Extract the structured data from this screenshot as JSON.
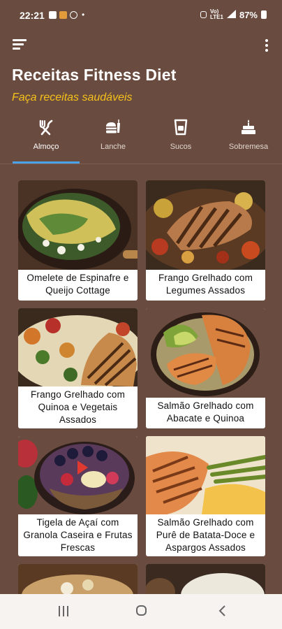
{
  "status": {
    "time": "22:21",
    "battery": "87%"
  },
  "header": {
    "title": "Receitas Fitness Diet",
    "subtitle": "Faça receitas saudáveis"
  },
  "tabs": [
    {
      "label": "Almoço",
      "icon": "cutlery-icon",
      "active": true
    },
    {
      "label": "Lanche",
      "icon": "burger-icon",
      "active": false
    },
    {
      "label": "Sucos",
      "icon": "cup-icon",
      "active": false
    },
    {
      "label": "Sobremesa",
      "icon": "cake-icon",
      "active": false
    }
  ],
  "recipes": [
    {
      "name_l1": "Omelete de Espinafre e",
      "name_l2": "Queijo Cottage",
      "name_l3": ""
    },
    {
      "name_l1": "Frango Grelhado com",
      "name_l2": "Legumes Assados",
      "name_l3": ""
    },
    {
      "name_l1": "Frango Grelhado com",
      "name_l2": "Quinoa e Vegetais",
      "name_l3": "Assados"
    },
    {
      "name_l1": "Salmão Grelhado com",
      "name_l2": "Abacate e Quinoa",
      "name_l3": ""
    },
    {
      "name_l1": "Tigela de Açaí com",
      "name_l2": "Granola Caseira e Frutas",
      "name_l3": "Frescas"
    },
    {
      "name_l1": "Salmão Grelhado com",
      "name_l2": "Purê de Batata-Doce e",
      "name_l3": "Aspargos Assados"
    }
  ],
  "colors": {
    "background": "#6a4b3f",
    "accent": "#f5c21a",
    "indicator": "#4aa3e8"
  }
}
